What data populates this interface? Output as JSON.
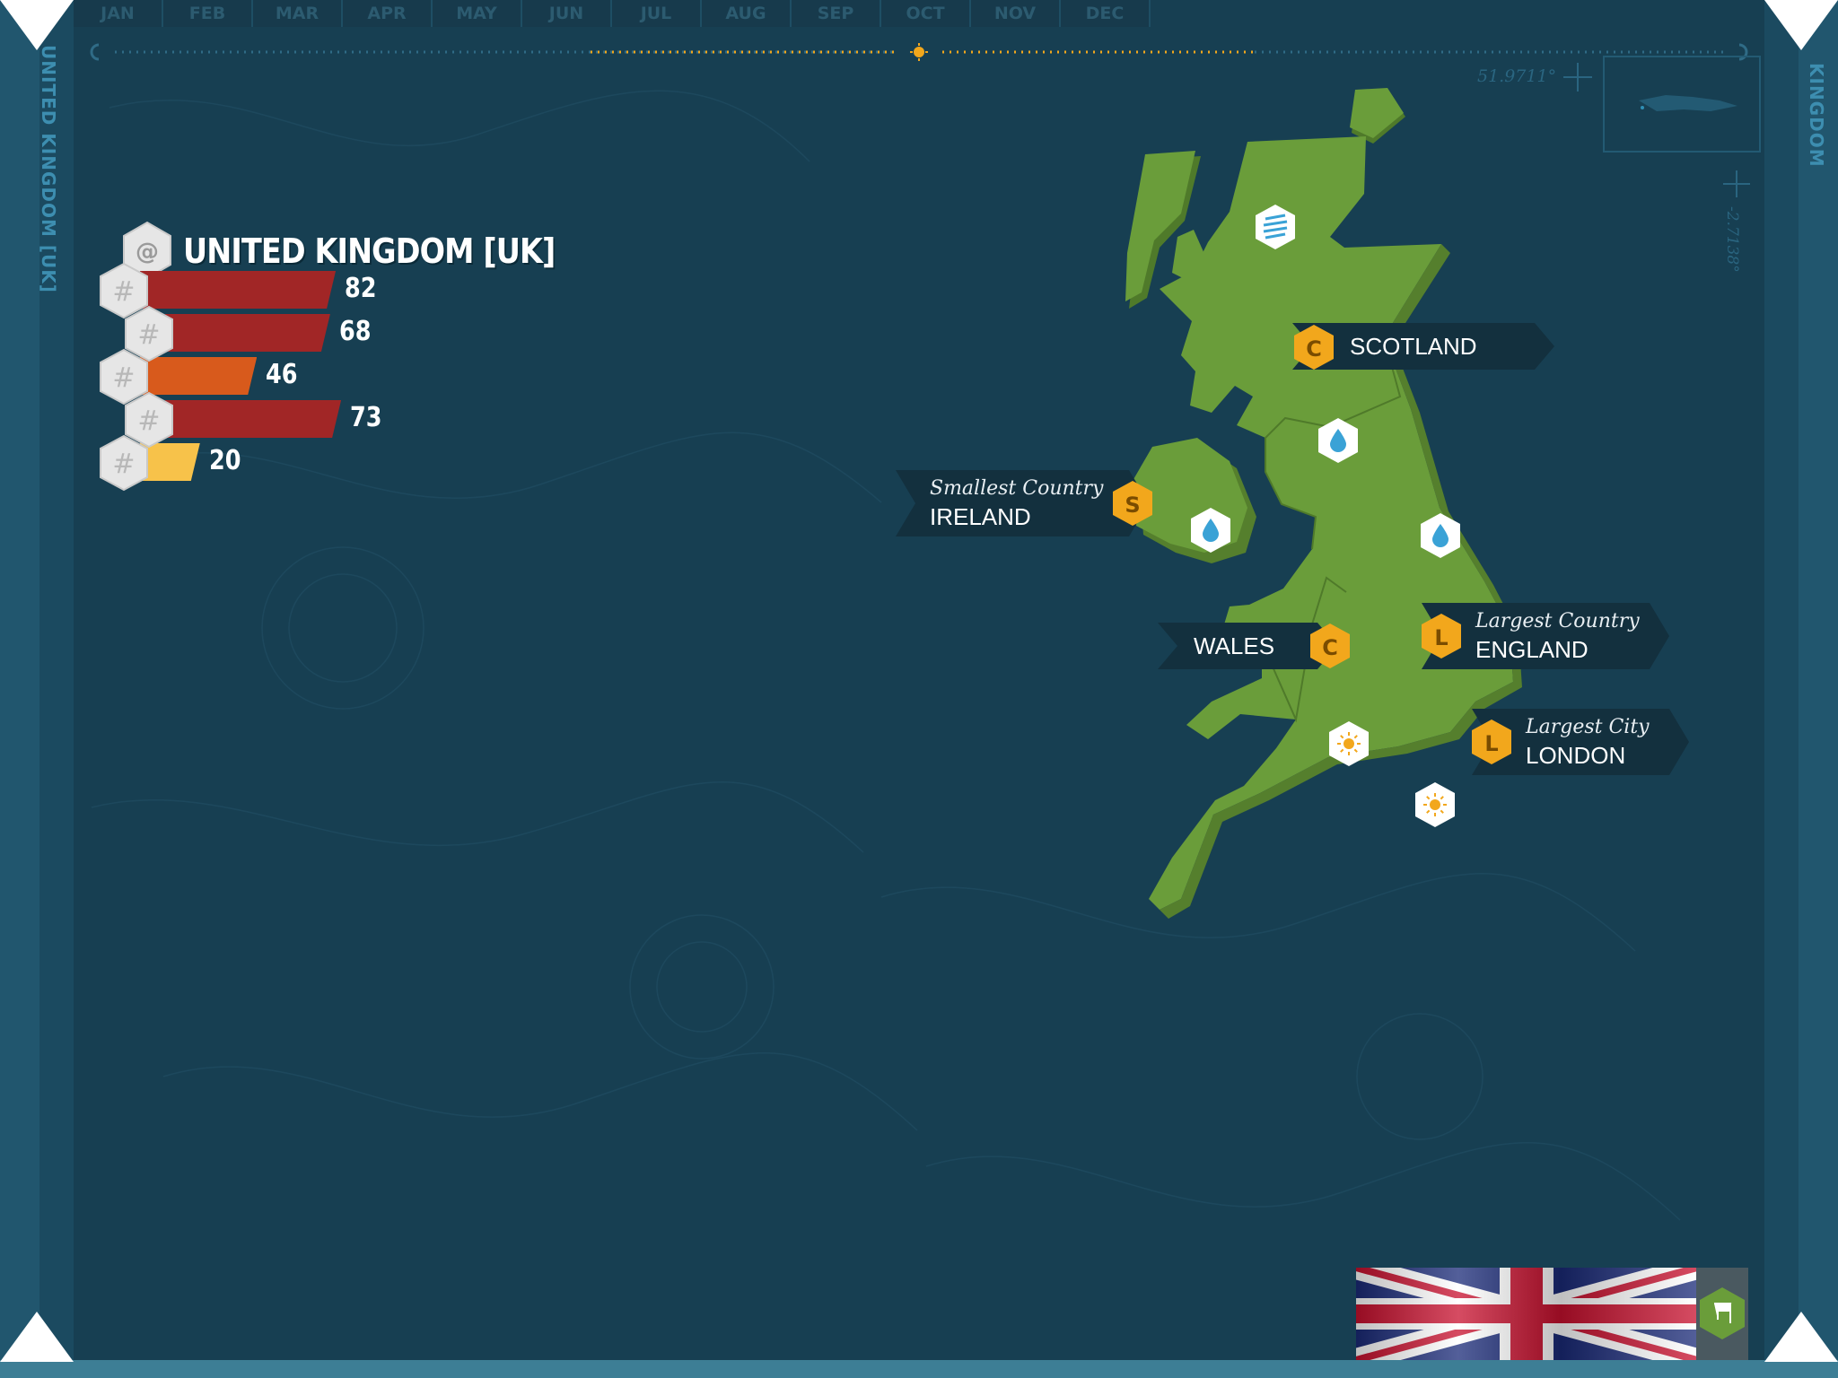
{
  "months": [
    "JAN",
    "FEB",
    "MAR",
    "APR",
    "MAY",
    "JUN",
    "JUL",
    "AUG",
    "SEP",
    "OCT",
    "NOV",
    "DEC"
  ],
  "sidebar": {
    "left_label": "UNITED KINGDOM [UK]",
    "right_label": "KINGDOM"
  },
  "coordinates": {
    "latitude": "51.9711°",
    "longitude": "-2.7138°"
  },
  "country": {
    "title": "UNITED KINGDOM [UK]",
    "title_icon": "at-icon"
  },
  "stats": [
    {
      "value": 82,
      "label": "82",
      "color": "#a12626",
      "icon": "hash-icon"
    },
    {
      "value": 68,
      "label": "68",
      "color": "#a12626",
      "icon": "hash-icon"
    },
    {
      "value": 46,
      "label": "46",
      "color": "#d85a1c",
      "icon": "hash-icon"
    },
    {
      "value": 73,
      "label": "73",
      "color": "#a12626",
      "icon": "hash-icon"
    },
    {
      "value": 20,
      "label": "20",
      "color": "#f7c24a",
      "icon": "hash-icon"
    }
  ],
  "map": {
    "land_color": "#6a9d3a",
    "labels": {
      "scotland": {
        "badge": "C",
        "name": "SCOTLAND"
      },
      "ireland": {
        "badge": "S",
        "subtitle": "Smallest Country",
        "name": "IRELAND"
      },
      "wales": {
        "badge": "C",
        "name": "WALES"
      },
      "england": {
        "badge": "L",
        "subtitle": "Largest Country",
        "name": "ENGLAND"
      },
      "london": {
        "badge": "L",
        "subtitle": "Largest City",
        "name": "LONDON"
      }
    },
    "weather_icons": [
      "wind-icon",
      "rain-icon",
      "rain-icon",
      "rain-icon",
      "sun-icon",
      "sun-icon"
    ]
  },
  "colors": {
    "background": "#173f52",
    "badge": "#f2a71c",
    "bar_red": "#a12626",
    "bar_orange": "#d85a1c",
    "bar_yellow": "#f7c24a"
  }
}
